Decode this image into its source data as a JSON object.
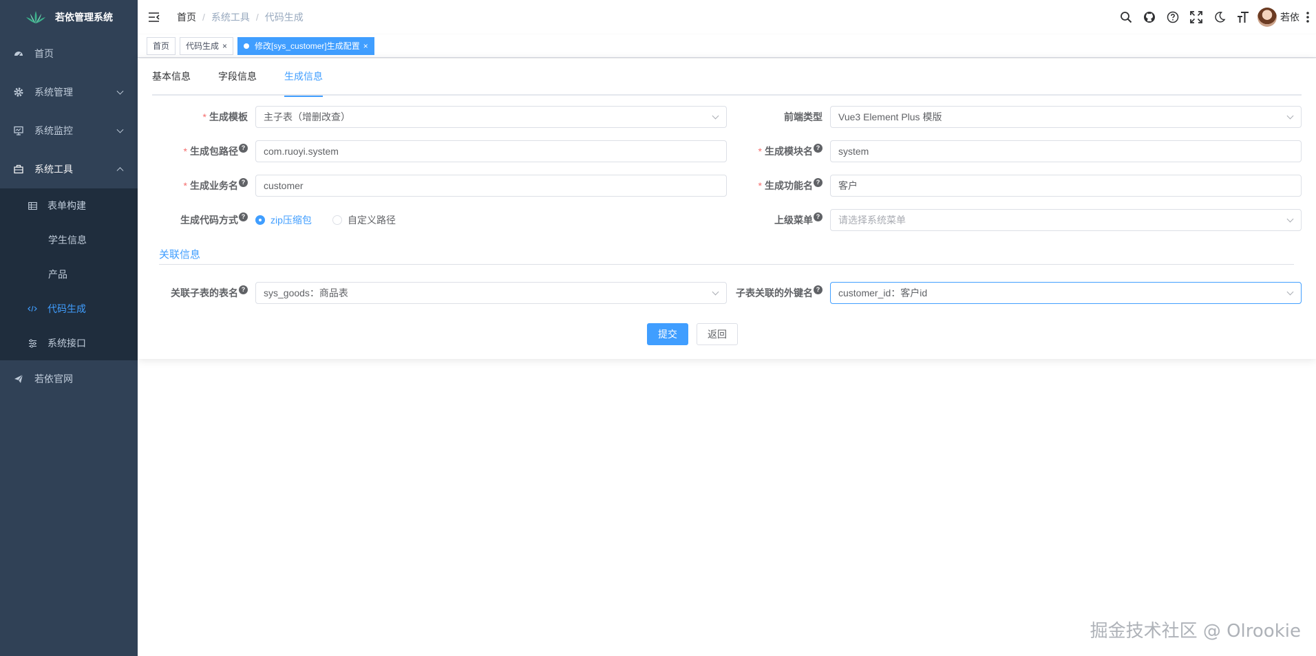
{
  "app": {
    "title": "若依管理系统"
  },
  "sidebar": {
    "items": [
      {
        "label": "首页",
        "icon": "dashboard-icon"
      },
      {
        "label": "系统管理",
        "icon": "gear-icon"
      },
      {
        "label": "系统监控",
        "icon": "monitor-icon"
      },
      {
        "label": "系统工具",
        "icon": "toolbox-icon"
      },
      {
        "label": "若依官网",
        "icon": "send-icon"
      }
    ],
    "tool_sub": [
      {
        "label": "表单构建",
        "icon": "table-icon"
      },
      {
        "label": "学生信息"
      },
      {
        "label": "产品"
      },
      {
        "label": "代码生成",
        "icon": "code-icon"
      },
      {
        "label": "系统接口",
        "icon": "sliders-icon"
      }
    ]
  },
  "navbar": {
    "breadcrumb": [
      "首页",
      "系统工具",
      "代码生成"
    ],
    "user": "若依"
  },
  "tags": [
    {
      "label": "首页"
    },
    {
      "label": "代码生成"
    },
    {
      "label": "修改[sys_customer]生成配置"
    }
  ],
  "tabs": [
    "基本信息",
    "字段信息",
    "生成信息"
  ],
  "form": {
    "tpl_category": {
      "label": "生成模板",
      "value": "主子表（增删改查）"
    },
    "frontend_type": {
      "label": "前端类型",
      "value": "Vue3 Element Plus 模版"
    },
    "package_name": {
      "label": "生成包路径",
      "value": "com.ruoyi.system"
    },
    "module_name": {
      "label": "生成模块名",
      "value": "system"
    },
    "business_name": {
      "label": "生成业务名",
      "value": "customer"
    },
    "function_name": {
      "label": "生成功能名",
      "value": "客户"
    },
    "gen_type": {
      "label": "生成代码方式",
      "options": [
        "zip压缩包",
        "自定义路径"
      ]
    },
    "parent_menu": {
      "label": "上级菜单",
      "placeholder": "请选择系统菜单"
    },
    "section_title": "关联信息",
    "sub_table": {
      "label": "关联子表的表名",
      "value": "sys_goods：商品表"
    },
    "sub_fk": {
      "label": "子表关联的外键名",
      "value": "customer_id：客户id"
    }
  },
  "buttons": {
    "submit": "提交",
    "back": "返回"
  },
  "watermark": "掘金技术社区 @ Olrookie",
  "colors": {
    "primary": "#409eff",
    "sidebar": "#304156",
    "submenu": "#1f2d3d",
    "required": "#f56c6c"
  }
}
